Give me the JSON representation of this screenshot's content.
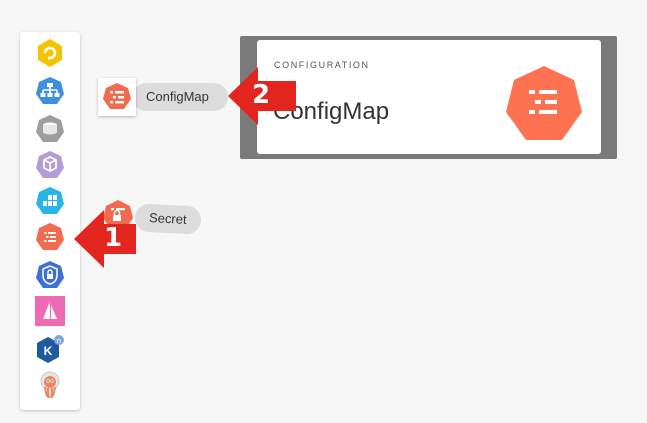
{
  "palette": {
    "items": [
      {
        "icon": "camel-k-icon",
        "color": "#f5c400"
      },
      {
        "icon": "kubernetes-deployment-icon",
        "color": "#3f8fe0"
      },
      {
        "icon": "database-icon",
        "color": "#9e9e9e"
      },
      {
        "icon": "knative-service-icon",
        "color": "#b49cd8"
      },
      {
        "icon": "knative-broker-icon",
        "color": "#29b6e6"
      },
      {
        "icon": "configmap-icon",
        "color": "#f26b4f"
      },
      {
        "icon": "secret-icon",
        "color": "#3d6fd8"
      },
      {
        "icon": "sailboat-icon",
        "color": "#ee6bb3"
      },
      {
        "icon": "kamelet-icon",
        "color": "#1f5a9e"
      },
      {
        "icon": "argo-octopus-icon",
        "color": "#f08560"
      }
    ]
  },
  "drag_items": {
    "configmap": {
      "label": "ConfigMap"
    },
    "secret": {
      "label": "Secret"
    }
  },
  "card": {
    "eyebrow": "CONFIGURATION",
    "title": "ConfigMap",
    "icon": "configmap-icon",
    "accent": "#fd7351"
  },
  "callouts": [
    {
      "number": "1",
      "color": "#e2261d"
    },
    {
      "number": "2",
      "color": "#e2261d"
    }
  ]
}
